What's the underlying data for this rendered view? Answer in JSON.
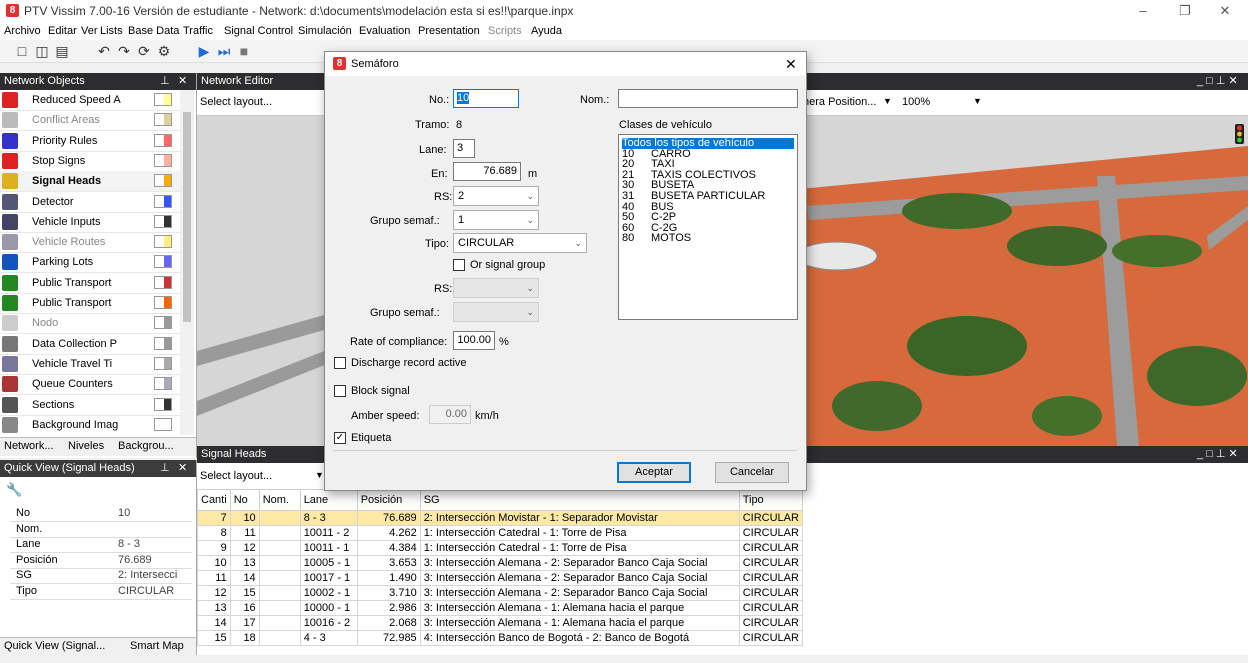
{
  "window": {
    "title": "PTV Vissim 7.00-16 Versión de estudiante - Network: d:\\documents\\modelación esta si es!!\\parque.inpx"
  },
  "menu": [
    "Archivo",
    "Editar",
    "Ver",
    "Lists",
    "Base Data",
    "Traffic",
    "Signal Control",
    "Simulación",
    "Evaluation",
    "Presentation",
    "Scripts",
    "Ayuda"
  ],
  "network_objects": {
    "title": "Network Objects",
    "items": [
      {
        "label": "Reduced Speed A",
        "icon": "reduced-speed-icon",
        "bold": false
      },
      {
        "label": "Conflict Areas",
        "icon": "conflict-areas-icon",
        "bold": false
      },
      {
        "label": "Priority Rules",
        "icon": "priority-rules-icon",
        "bold": false
      },
      {
        "label": "Stop Signs",
        "icon": "stop-sign-icon",
        "bold": false
      },
      {
        "label": "Signal Heads",
        "icon": "signal-head-icon",
        "bold": true
      },
      {
        "label": "Detector",
        "icon": "detector-icon",
        "bold": false
      },
      {
        "label": "Vehicle Inputs",
        "icon": "vehicle-input-icon",
        "bold": false
      },
      {
        "label": "Vehicle Routes",
        "icon": "vehicle-routes-icon",
        "bold": false
      },
      {
        "label": "Parking Lots",
        "icon": "parking-icon",
        "bold": false
      },
      {
        "label": "Public Transport",
        "icon": "pt-stop-icon",
        "bold": false
      },
      {
        "label": "Public Transport",
        "icon": "pt-line-icon",
        "bold": false
      },
      {
        "label": "Nodo",
        "icon": "node-icon",
        "bold": false
      },
      {
        "label": "Data Collection P",
        "icon": "data-collection-icon",
        "bold": false
      },
      {
        "label": "Vehicle Travel Ti",
        "icon": "travel-time-icon",
        "bold": false
      },
      {
        "label": "Queue Counters",
        "icon": "queue-counter-icon",
        "bold": false
      },
      {
        "label": "Sections",
        "icon": "sections-icon",
        "bold": false
      },
      {
        "label": "Background Imag",
        "icon": "background-image-icon",
        "bold": false
      }
    ],
    "tabs": [
      "Network...",
      "Niveles",
      "Backgrou..."
    ]
  },
  "quick_view": {
    "title": "Quick View (Signal Heads)",
    "rows": [
      {
        "k": "No",
        "v": "10"
      },
      {
        "k": "Nom.",
        "v": ""
      },
      {
        "k": "Lane",
        "v": "8 - 3"
      },
      {
        "k": "Posición",
        "v": "76.689"
      },
      {
        "k": "SG",
        "v": "2: Intersecci"
      },
      {
        "k": "Tipo",
        "v": "CIRCULAR"
      }
    ],
    "tabs": [
      "Quick View (Signal...",
      "Smart Map"
    ]
  },
  "editor": {
    "title": "Network Editor",
    "layout_placeholder": "Select layout...",
    "camera": "nera Position...",
    "zoom": "100%"
  },
  "signal_heads": {
    "title": "Signal Heads",
    "layout_placeholder": "Select layout...",
    "columns": [
      "Canti",
      "No",
      "Nom.",
      "Lane",
      "Posición",
      "SG",
      "Tipo"
    ],
    "rows": [
      [
        "7",
        "10",
        "",
        "8 - 3",
        "76.689",
        "2: Intersección Movistar - 1: Separador Movistar",
        "CIRCULAR"
      ],
      [
        "8",
        "11",
        "",
        "10011 - 2",
        "4.262",
        "1: Intersección Catedral  - 1: Torre de Pisa",
        "CIRCULAR"
      ],
      [
        "9",
        "12",
        "",
        "10011 - 1",
        "4.384",
        "1: Intersección Catedral  - 1: Torre de Pisa",
        "CIRCULAR"
      ],
      [
        "10",
        "13",
        "",
        "10005 - 1",
        "3.653",
        "3: Intersección Alemana - 2: Separador Banco Caja Social",
        "CIRCULAR"
      ],
      [
        "11",
        "14",
        "",
        "10017 - 1",
        "1.490",
        "3: Intersección Alemana - 2: Separador Banco Caja Social",
        "CIRCULAR"
      ],
      [
        "12",
        "15",
        "",
        "10002 - 1",
        "3.710",
        "3: Intersección Alemana - 2: Separador Banco Caja Social",
        "CIRCULAR"
      ],
      [
        "13",
        "16",
        "",
        "10000 - 1",
        "2.986",
        "3: Intersección Alemana - 1: Alemana hacia el parque",
        "CIRCULAR"
      ],
      [
        "14",
        "17",
        "",
        "10016 - 2",
        "2.068",
        "3: Intersección Alemana - 1: Alemana hacia el parque",
        "CIRCULAR"
      ],
      [
        "15",
        "18",
        "",
        "4 - 3",
        "72.985",
        "4: Intersección Banco de Bogotá - 2: Banco de Bogotá",
        "CIRCULAR"
      ]
    ]
  },
  "dialog": {
    "title": "Semáforo",
    "no_label": "No.:",
    "no_value": "10",
    "nom_label": "Nom.:",
    "nom_value": "",
    "tramo_label": "Tramo:",
    "tramo_value": "8",
    "lane_label": "Lane:",
    "lane_value": "3",
    "en_label": "En:",
    "en_value": "76.689",
    "en_unit": "m",
    "rs_label": "RS:",
    "rs_value": "2",
    "grupo_label": "Grupo semaf.:",
    "grupo_value": "1",
    "tipo_label": "Tipo:",
    "tipo_value": "CIRCULAR",
    "or_signal_label": "Or signal group",
    "rs2_label": "RS:",
    "grupo2_label": "Grupo semaf.:",
    "compliance_label": "Rate of compliance:",
    "compliance_value": "100.00",
    "compliance_unit": "%",
    "discharge_label": "Discharge record active",
    "block_label": "Block signal",
    "amber_label": "Amber speed:",
    "amber_value": "0.00",
    "amber_unit": "km/h",
    "etiqueta_label": "Etiqueta",
    "vc_title": "Clases de vehículo",
    "vehicle_classes": [
      {
        "n": "",
        "name": "Todos los tipos de vehículo"
      },
      {
        "n": "10",
        "name": "CARRO"
      },
      {
        "n": "20",
        "name": "TAXI"
      },
      {
        "n": "21",
        "name": "TAXIS COLECTIVOS"
      },
      {
        "n": "30",
        "name": "BUSETA"
      },
      {
        "n": "31",
        "name": "BUSETA PARTICULAR"
      },
      {
        "n": "40",
        "name": "BUS"
      },
      {
        "n": "50",
        "name": "C-2P"
      },
      {
        "n": "60",
        "name": "C-2G"
      },
      {
        "n": "80",
        "name": "MOTOS"
      }
    ],
    "ok_label": "Aceptar",
    "cancel_label": "Cancelar"
  },
  "colors": {
    "accent": "#0078d7",
    "selected_row": "#fde9a5",
    "panel_header": "#2d2d30",
    "ground": "#d66a3c"
  }
}
